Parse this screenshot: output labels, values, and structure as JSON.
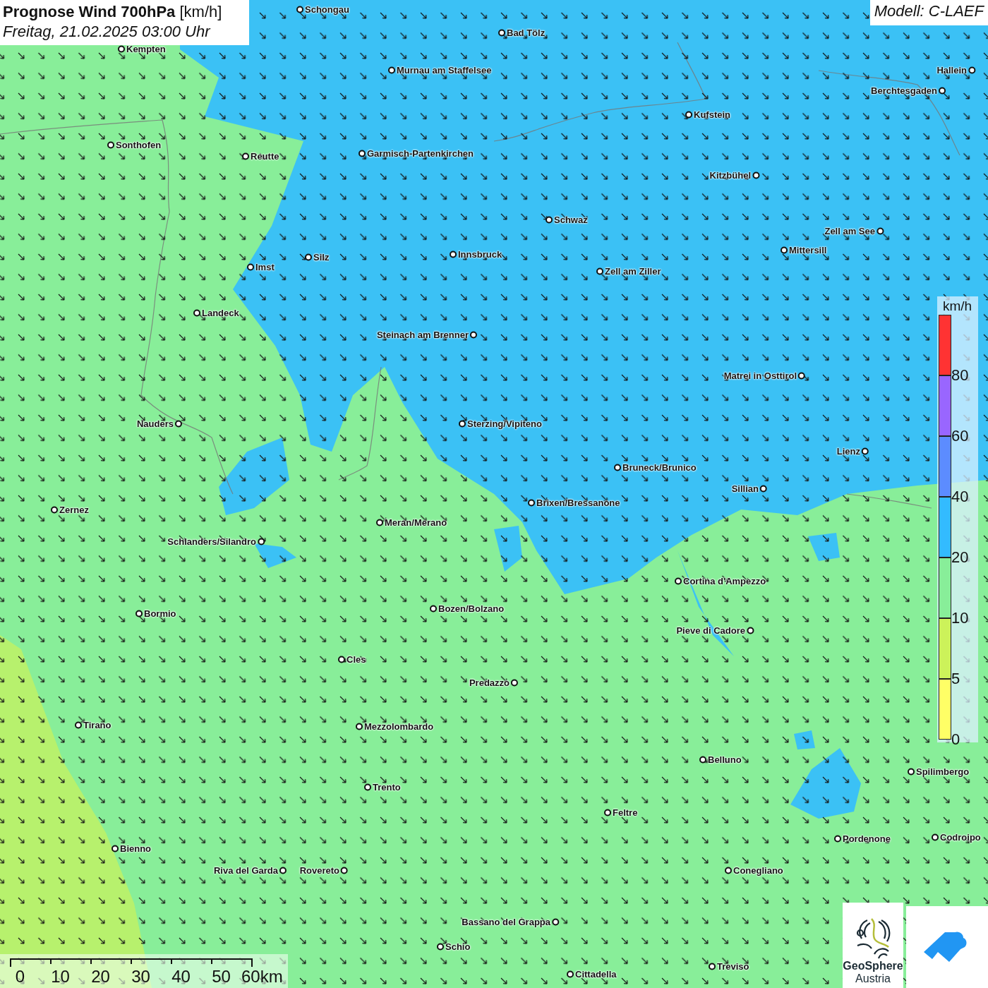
{
  "title": {
    "main": "Prognose Wind 700hPa",
    "unit": "[km/h]",
    "date": "Freitag, 21.02.2025 03:00 Uhr"
  },
  "model": "Modell: C-LAEF",
  "cities": [
    {
      "name": "Schongau"
    },
    {
      "name": "Bad Tölz"
    },
    {
      "name": "Kempten"
    },
    {
      "name": "Murnau am Staffelsee"
    },
    {
      "name": "Hallein"
    },
    {
      "name": "Berchtesgaden"
    },
    {
      "name": "Kufstein"
    },
    {
      "name": "Sonthofen"
    },
    {
      "name": "Reutte"
    },
    {
      "name": "Garmisch-Partenkirchen"
    },
    {
      "name": "Kitzbühel"
    },
    {
      "name": "Schwaz"
    },
    {
      "name": "Zell am See"
    },
    {
      "name": "Mittersill"
    },
    {
      "name": "Innsbruck"
    },
    {
      "name": "Silz"
    },
    {
      "name": "Imst"
    },
    {
      "name": "Zell am Ziller"
    },
    {
      "name": "Landeck"
    },
    {
      "name": "Steinach am Brenner"
    },
    {
      "name": "Matrei in Osttirol"
    },
    {
      "name": "Nauders"
    },
    {
      "name": "Sterzing/Vipiteno"
    },
    {
      "name": "Lienz"
    },
    {
      "name": "Bruneck/Brunico"
    },
    {
      "name": "Sillian"
    },
    {
      "name": "Brixen/Bressanone"
    },
    {
      "name": "Zernez"
    },
    {
      "name": "Meran/Merano"
    },
    {
      "name": "Schlanders/Silandro"
    },
    {
      "name": "Cortina d'Ampezzo"
    },
    {
      "name": "Bozen/Bolzano"
    },
    {
      "name": "Bormio"
    },
    {
      "name": "Pieve di Cadore"
    },
    {
      "name": "Cles"
    },
    {
      "name": "Predazzo"
    },
    {
      "name": "Tirano"
    },
    {
      "name": "Mezzolombardo"
    },
    {
      "name": "Belluno"
    },
    {
      "name": "Spilimbergo"
    },
    {
      "name": "Trento"
    },
    {
      "name": "Feltre"
    },
    {
      "name": "Pordenone"
    },
    {
      "name": "Codroipo"
    },
    {
      "name": "Bienno"
    },
    {
      "name": "Riva del Garda"
    },
    {
      "name": "Rovereto"
    },
    {
      "name": "Conegliano"
    },
    {
      "name": "Bassano del Grappa"
    },
    {
      "name": "Schio"
    },
    {
      "name": "Treviso"
    },
    {
      "name": "Cittadella"
    }
  ],
  "legend": {
    "unit": "km/h",
    "bands": [
      {
        "label": "80",
        "color": "#ff3333"
      },
      {
        "label": "60",
        "color": "#9966ff"
      },
      {
        "label": "40",
        "color": "#5c8cff"
      },
      {
        "label": "20",
        "color": "#33bbff"
      },
      {
        "label": "10",
        "color": "#88ee99"
      },
      {
        "label": "5",
        "color": "#ccf25a"
      },
      {
        "label": "0",
        "color": "#ffff66"
      }
    ]
  },
  "scale": {
    "labels": [
      "0",
      "10",
      "20",
      "30",
      "40",
      "50",
      "60km"
    ]
  },
  "logo": {
    "name": "GeoSphere",
    "sub": "Austria"
  }
}
